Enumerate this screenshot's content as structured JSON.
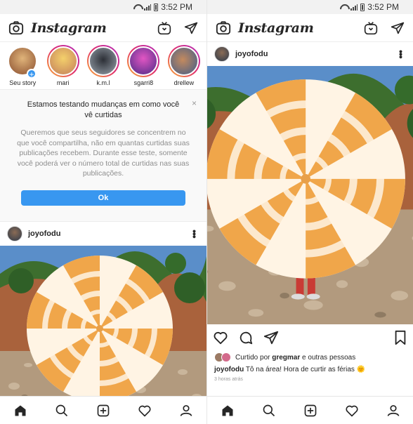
{
  "status": {
    "time": "3:52 PM"
  },
  "app": {
    "logo": "Instagram"
  },
  "stories": [
    {
      "name": "Seu story",
      "color": "#d7a25c"
    },
    {
      "name": "mari",
      "color": "#c27d5b"
    },
    {
      "name": "k.m.l",
      "color": "#5f6b7a"
    },
    {
      "name": "sgarri8",
      "color": "#b33f8e"
    },
    {
      "name": "drellew",
      "color": "#8a5a3c"
    }
  ],
  "notice": {
    "title": "Estamos testando mudanças em como você vê curtidas",
    "body": "Queremos que seus seguidores se concentrem no que você compartilha, não em quantas curtidas suas publicações recebem. Durante esse teste, somente você poderá ver o número total de curtidas nas suas publicações.",
    "ok_label": "Ok",
    "close_glyph": "×"
  },
  "post": {
    "username": "joyofodu",
    "likes_prefix": "Curtido por",
    "likes_user": "gregmar",
    "likes_suffix": "e outras pessoas",
    "caption_user": "joyofodu",
    "caption_text": "Tô na área! Hora de curtir as férias 🌞",
    "time": "3 horas atrás"
  },
  "colors": {
    "accent": "#3897f0",
    "stripe": "#f0a64a"
  }
}
